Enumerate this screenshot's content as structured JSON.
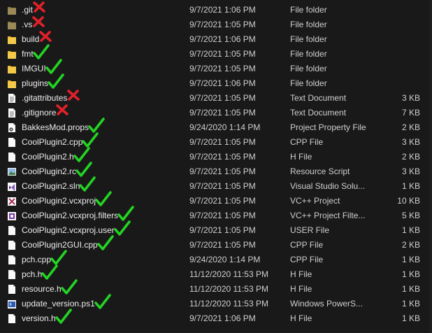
{
  "colors": {
    "check": "#23d423",
    "cross": "#e3202a",
    "background": "#191919"
  },
  "files": [
    {
      "name": ".git",
      "date": "9/7/2021 1:06 PM",
      "type": "File folder",
      "size": "",
      "icon": "folder-hidden-icon",
      "mark": "cross"
    },
    {
      "name": ".vs",
      "date": "9/7/2021 1:05 PM",
      "type": "File folder",
      "size": "",
      "icon": "folder-hidden-icon",
      "mark": "cross"
    },
    {
      "name": "build",
      "date": "9/7/2021 1:06 PM",
      "type": "File folder",
      "size": "",
      "icon": "folder-icon",
      "mark": "cross"
    },
    {
      "name": "fmt",
      "date": "9/7/2021 1:05 PM",
      "type": "File folder",
      "size": "",
      "icon": "folder-icon",
      "mark": "check"
    },
    {
      "name": "IMGUI",
      "date": "9/7/2021 1:05 PM",
      "type": "File folder",
      "size": "",
      "icon": "folder-icon",
      "mark": "check"
    },
    {
      "name": "plugins",
      "date": "9/7/2021 1:06 PM",
      "type": "File folder",
      "size": "",
      "icon": "folder-icon",
      "mark": "check"
    },
    {
      "name": ".gitattributes",
      "date": "9/7/2021 1:05 PM",
      "type": "Text Document",
      "size": "3 KB",
      "icon": "text-file-icon",
      "mark": "cross"
    },
    {
      "name": ".gitignore",
      "date": "9/7/2021 1:05 PM",
      "type": "Text Document",
      "size": "7 KB",
      "icon": "text-file-icon",
      "mark": "cross"
    },
    {
      "name": "BakkesMod.props",
      "date": "9/24/2020 1:14 PM",
      "type": "Project Property File",
      "size": "2 KB",
      "icon": "props-file-icon",
      "mark": "check"
    },
    {
      "name": "CoolPlugin2.cpp",
      "date": "9/7/2021 1:05 PM",
      "type": "CPP File",
      "size": "3 KB",
      "icon": "blank-file-icon",
      "mark": "check"
    },
    {
      "name": "CoolPlugin2.h",
      "date": "9/7/2021 1:05 PM",
      "type": "H File",
      "size": "2 KB",
      "icon": "blank-file-icon",
      "mark": "check"
    },
    {
      "name": "CoolPlugin2.rc",
      "date": "9/7/2021 1:05 PM",
      "type": "Resource Script",
      "size": "3 KB",
      "icon": "resource-file-icon",
      "mark": "check"
    },
    {
      "name": "CoolPlugin2.sln",
      "date": "9/7/2021 1:05 PM",
      "type": "Visual Studio Solu...",
      "size": "1 KB",
      "icon": "visual-studio-icon",
      "mark": "check"
    },
    {
      "name": "CoolPlugin2.vcxproj",
      "date": "9/7/2021 1:05 PM",
      "type": "VC++ Project",
      "size": "10 KB",
      "icon": "vcxproj-icon",
      "mark": "check"
    },
    {
      "name": "CoolPlugin2.vcxproj.filters",
      "date": "9/7/2021 1:05 PM",
      "type": "VC++ Project Filte...",
      "size": "5 KB",
      "icon": "filters-file-icon",
      "mark": "check"
    },
    {
      "name": "CoolPlugin2.vcxproj.user",
      "date": "9/7/2021 1:05 PM",
      "type": "USER File",
      "size": "1 KB",
      "icon": "blank-file-icon",
      "mark": "check"
    },
    {
      "name": "CoolPlugin2GUI.cpp",
      "date": "9/7/2021 1:05 PM",
      "type": "CPP File",
      "size": "2 KB",
      "icon": "blank-file-icon",
      "mark": "check"
    },
    {
      "name": "pch.cpp",
      "date": "9/24/2020 1:14 PM",
      "type": "CPP File",
      "size": "1 KB",
      "icon": "blank-file-icon",
      "mark": "check"
    },
    {
      "name": "pch.h",
      "date": "11/12/2020 11:53 PM",
      "type": "H File",
      "size": "1 KB",
      "icon": "blank-file-icon",
      "mark": "check"
    },
    {
      "name": "resource.h",
      "date": "11/12/2020 11:53 PM",
      "type": "H File",
      "size": "1 KB",
      "icon": "blank-file-icon",
      "mark": "check"
    },
    {
      "name": "update_version.ps1",
      "date": "11/12/2020 11:53 PM",
      "type": "Windows PowerS...",
      "size": "1 KB",
      "icon": "powershell-file-icon",
      "mark": "check"
    },
    {
      "name": "version.h",
      "date": "9/7/2021 1:06 PM",
      "type": "H File",
      "size": "1 KB",
      "icon": "blank-file-icon",
      "mark": "check"
    }
  ]
}
